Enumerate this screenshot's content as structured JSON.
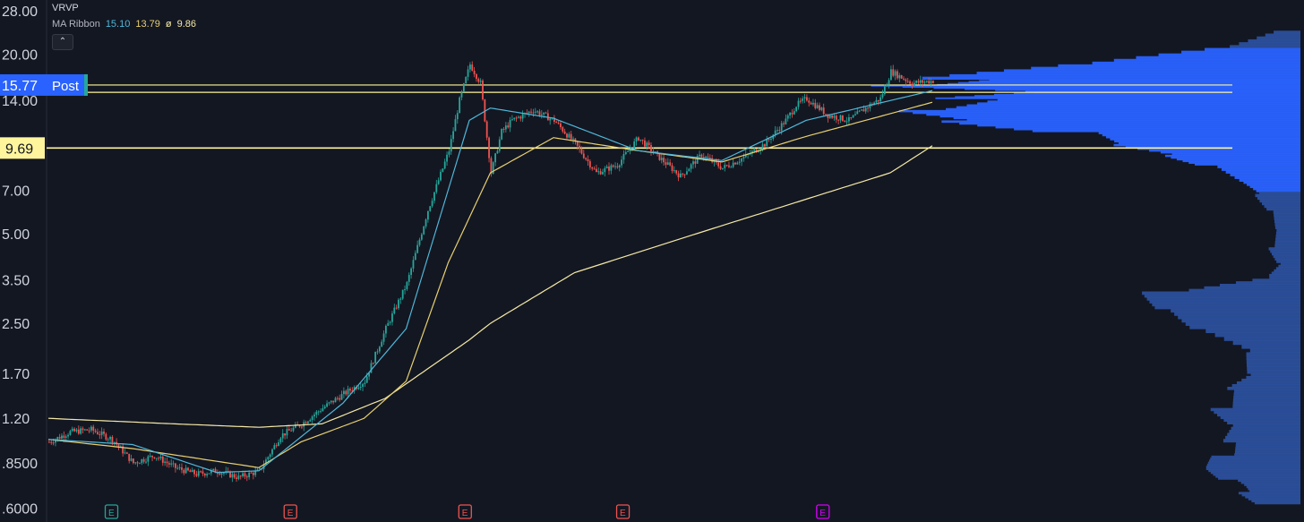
{
  "legend": {
    "vrvp_label": "VRVP",
    "ma_label": "MA Ribbon",
    "ma_values": [
      "15.10",
      "13.79",
      "9.86"
    ],
    "ma_sep": "ø",
    "collapse_glyph": "⌃"
  },
  "colors": {
    "bg": "#131722",
    "up": "#26a69a",
    "down": "#ef5350",
    "ma_fast": "#4fb8d9",
    "ma_mid": "#e8d070",
    "ma_slow": "#f5e9a6",
    "hline": "#fff59d",
    "vrvp": "#2962ff",
    "vrvp_dim": "#2b4f9c",
    "badge_blue": "#2962ff",
    "badge_yellow": "#fff59d"
  },
  "chart_data": {
    "type": "candlestick",
    "scale": "log",
    "ylim": [
      0.55,
      30
    ],
    "y_ticks": [
      "28.00",
      "20.00",
      "14.00",
      "9.69",
      "7.00",
      "5.00",
      "3.50",
      "2.50",
      "1.70",
      "1.20",
      ".8500",
      ".6000"
    ],
    "price_badges": [
      {
        "label": "15.77",
        "tag": "Post",
        "value": 15.77
      },
      {
        "label": "9.69",
        "value": 9.69
      }
    ],
    "hlines": [
      15.77,
      14.9,
      9.69
    ],
    "event_markers": [
      {
        "label": "E",
        "kind": "earnings-past-green",
        "bar": 30
      },
      {
        "label": "E",
        "kind": "earnings-past-red",
        "bar": 115
      },
      {
        "label": "E",
        "kind": "earnings-past-red",
        "bar": 198
      },
      {
        "label": "E",
        "kind": "earnings-past-red",
        "bar": 273
      },
      {
        "label": "E",
        "kind": "earnings-future",
        "bar": 368
      }
    ],
    "price_anchors": [
      [
        0,
        1.0
      ],
      [
        10,
        1.08
      ],
      [
        20,
        1.1
      ],
      [
        30,
        1.02
      ],
      [
        40,
        0.85
      ],
      [
        50,
        0.9
      ],
      [
        60,
        0.82
      ],
      [
        70,
        0.78
      ],
      [
        80,
        0.8
      ],
      [
        90,
        0.76
      ],
      [
        100,
        0.8
      ],
      [
        110,
        1.05
      ],
      [
        120,
        1.15
      ],
      [
        130,
        1.3
      ],
      [
        140,
        1.45
      ],
      [
        150,
        1.6
      ],
      [
        160,
        2.4
      ],
      [
        170,
        3.4
      ],
      [
        180,
        6.0
      ],
      [
        190,
        9.5
      ],
      [
        195,
        14.0
      ],
      [
        200,
        18.5
      ],
      [
        205,
        16.0
      ],
      [
        210,
        8.0
      ],
      [
        215,
        11.0
      ],
      [
        220,
        12.0
      ],
      [
        230,
        13.0
      ],
      [
        240,
        12.0
      ],
      [
        250,
        10.0
      ],
      [
        260,
        8.0
      ],
      [
        270,
        8.5
      ],
      [
        280,
        10.5
      ],
      [
        290,
        9.0
      ],
      [
        300,
        7.8
      ],
      [
        310,
        9.2
      ],
      [
        320,
        8.3
      ],
      [
        330,
        9.0
      ],
      [
        340,
        10.0
      ],
      [
        350,
        12.0
      ],
      [
        355,
        13.5
      ],
      [
        360,
        14.2
      ],
      [
        370,
        12.5
      ],
      [
        380,
        12.0
      ],
      [
        390,
        13.5
      ],
      [
        395,
        14.2
      ],
      [
        400,
        17.5
      ],
      [
        410,
        16.0
      ],
      [
        420,
        16.3
      ]
    ],
    "ma_ribbon": {
      "fast": [
        [
          0,
          1.02
        ],
        [
          40,
          0.98
        ],
        [
          80,
          0.79
        ],
        [
          100,
          0.8
        ],
        [
          140,
          1.35
        ],
        [
          170,
          2.4
        ],
        [
          200,
          12.0
        ],
        [
          210,
          13.2
        ],
        [
          240,
          12.2
        ],
        [
          280,
          9.5
        ],
        [
          320,
          8.8
        ],
        [
          360,
          12.0
        ],
        [
          420,
          15.1
        ]
      ],
      "mid": [
        [
          0,
          1.02
        ],
        [
          40,
          0.95
        ],
        [
          100,
          0.82
        ],
        [
          120,
          1.0
        ],
        [
          150,
          1.2
        ],
        [
          170,
          1.6
        ],
        [
          190,
          4.0
        ],
        [
          210,
          8.0
        ],
        [
          240,
          10.5
        ],
        [
          280,
          9.5
        ],
        [
          320,
          8.7
        ],
        [
          360,
          10.6
        ],
        [
          420,
          13.8
        ]
      ],
      "slow": [
        [
          0,
          1.2
        ],
        [
          60,
          1.15
        ],
        [
          100,
          1.12
        ],
        [
          130,
          1.15
        ],
        [
          160,
          1.4
        ],
        [
          200,
          2.2
        ],
        [
          210,
          2.5
        ],
        [
          250,
          3.7
        ],
        [
          300,
          4.8
        ],
        [
          350,
          6.2
        ],
        [
          400,
          8.0
        ],
        [
          420,
          9.86
        ]
      ]
    },
    "vrvp_profile": [
      [
        24.0,
        0.08
      ],
      [
        21.0,
        0.22
      ],
      [
        18.5,
        0.55
      ],
      [
        16.5,
        0.9
      ],
      [
        15.77,
        1.0
      ],
      [
        15.0,
        0.6
      ],
      [
        14.2,
        0.85
      ],
      [
        13.0,
        0.95
      ],
      [
        12.0,
        0.8
      ],
      [
        11.0,
        0.55
      ],
      [
        10.0,
        0.45
      ],
      [
        9.2,
        0.3
      ],
      [
        8.5,
        0.22
      ],
      [
        7.5,
        0.14
      ],
      [
        6.8,
        0.1
      ],
      [
        6.0,
        0.07
      ],
      [
        5.2,
        0.06
      ],
      [
        4.5,
        0.07
      ],
      [
        4.0,
        0.05
      ],
      [
        3.6,
        0.08
      ],
      [
        3.2,
        0.35
      ],
      [
        2.8,
        0.32
      ],
      [
        2.4,
        0.25
      ],
      [
        2.0,
        0.12
      ],
      [
        1.7,
        0.12
      ],
      [
        1.5,
        0.18
      ],
      [
        1.3,
        0.2
      ],
      [
        1.15,
        0.16
      ],
      [
        1.0,
        0.18
      ],
      [
        0.9,
        0.2
      ],
      [
        0.82,
        0.22
      ],
      [
        0.75,
        0.18
      ],
      [
        0.68,
        0.14
      ],
      [
        0.62,
        0.1
      ]
    ]
  }
}
